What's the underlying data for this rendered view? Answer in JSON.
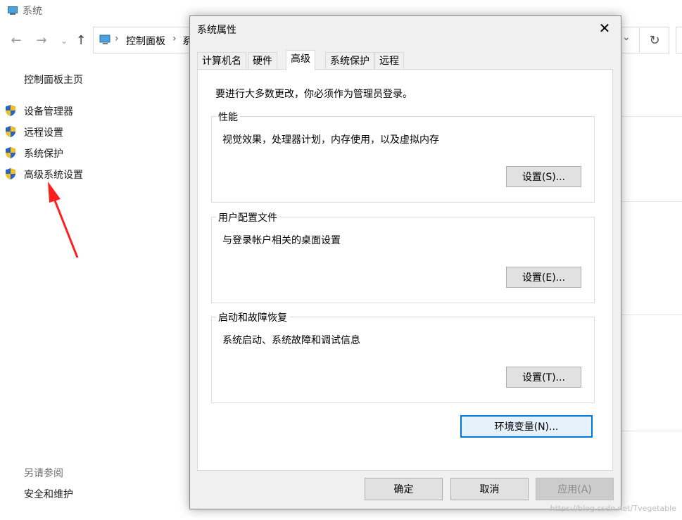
{
  "background": {
    "title": "系统",
    "breadcrumb": "控制面板",
    "breadcrumb_cut": "系",
    "sidebar": {
      "home": "控制面板主页",
      "items": [
        {
          "label": "设备管理器",
          "icon": "uac-shield-icon"
        },
        {
          "label": "远程设置",
          "icon": "uac-shield-icon"
        },
        {
          "label": "系统保护",
          "icon": "uac-shield-icon"
        },
        {
          "label": "高级系统设置",
          "icon": "uac-shield-icon"
        }
      ],
      "see_also_header": "另请参阅",
      "see_also_link": "安全和维护"
    }
  },
  "dialog": {
    "title": "系统属性",
    "tabs": [
      "计算机名",
      "硬件",
      "高级",
      "系统保护",
      "远程"
    ],
    "active_tab": "高级",
    "admin_note": "要进行大多数更改，你必须作为管理员登录。",
    "groups": [
      {
        "title": "性能",
        "description": "视觉效果，处理器计划，内存使用，以及虚拟内存",
        "button": "设置(S)..."
      },
      {
        "title": "用户配置文件",
        "description": "与登录帐户相关的桌面设置",
        "button": "设置(E)..."
      },
      {
        "title": "启动和故障恢复",
        "description": "系统启动、系统故障和调试信息",
        "button": "设置(T)..."
      }
    ],
    "env_button": "环境变量(N)...",
    "ok": "确定",
    "cancel": "取消",
    "apply": "应用(A)"
  },
  "colors": {
    "annotation_arrow": "#ff1f1f",
    "focus_border": "#0078d7"
  },
  "watermark": "https://blog.csdn.net/Tvegetable"
}
